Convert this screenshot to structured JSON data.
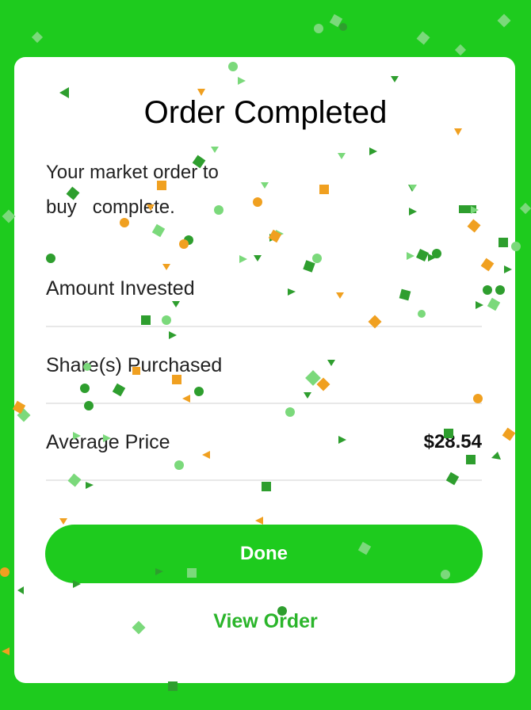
{
  "modal": {
    "title": "Order Completed",
    "message": "Your market order to buy   complete."
  },
  "summary": [
    {
      "label": "Amount Invested",
      "value": ""
    },
    {
      "label": "Share(s) Purchased",
      "value": ""
    },
    {
      "label": "Average Price",
      "value": "$28.54"
    }
  ],
  "actions": {
    "done_label": "Done",
    "view_order_label": "View Order"
  },
  "colors": {
    "accent_green": "#1ecb1e",
    "confetti_dark_green": "#2e9e2e",
    "confetti_light_green": "#7bd97b",
    "confetti_orange": "#f0a020"
  }
}
